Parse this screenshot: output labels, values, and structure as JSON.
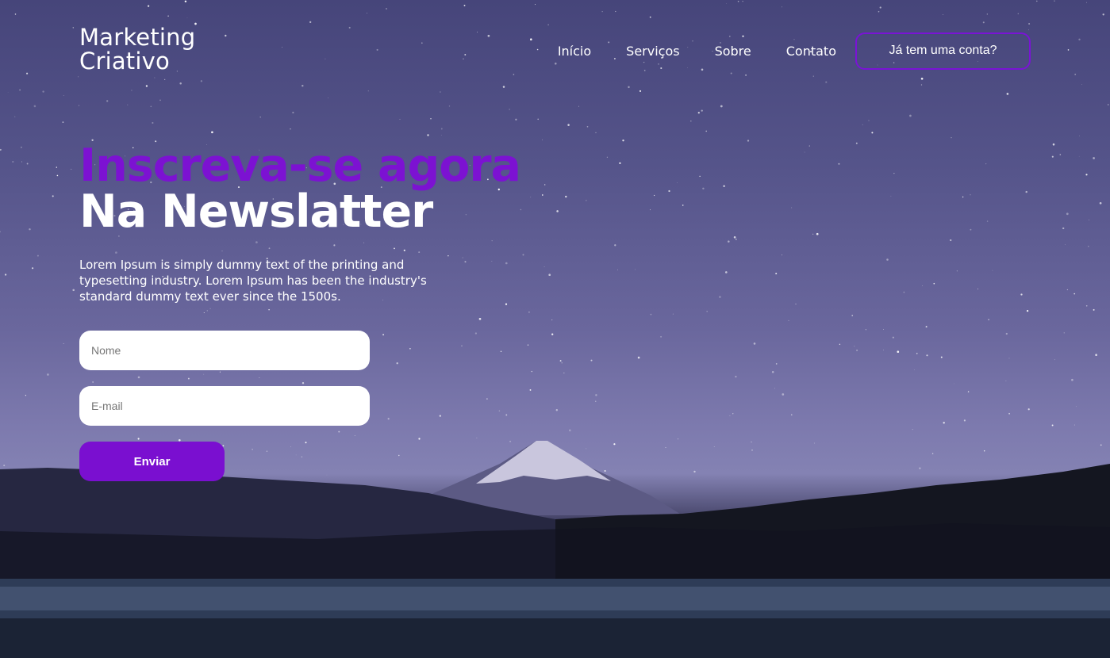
{
  "brand": {
    "line1": "Marketing",
    "line2": "Criativo"
  },
  "nav": {
    "links": [
      "Início",
      "Serviços",
      "Sobre",
      "Contato"
    ],
    "account_button": "Já tem uma conta?"
  },
  "hero": {
    "title_highlight": "Inscreva-se agora",
    "title_main": "Na Newslatter",
    "description": "Lorem Ipsum is simply dummy text of the printing and typesetting industry. Lorem Ipsum has been the industry's standard dummy text ever since the 1500s."
  },
  "form": {
    "name_placeholder": "Nome",
    "email_placeholder": "E-mail",
    "submit_label": "Enviar"
  },
  "colors": {
    "accent": "#7a0fd0",
    "text": "#ffffff"
  }
}
